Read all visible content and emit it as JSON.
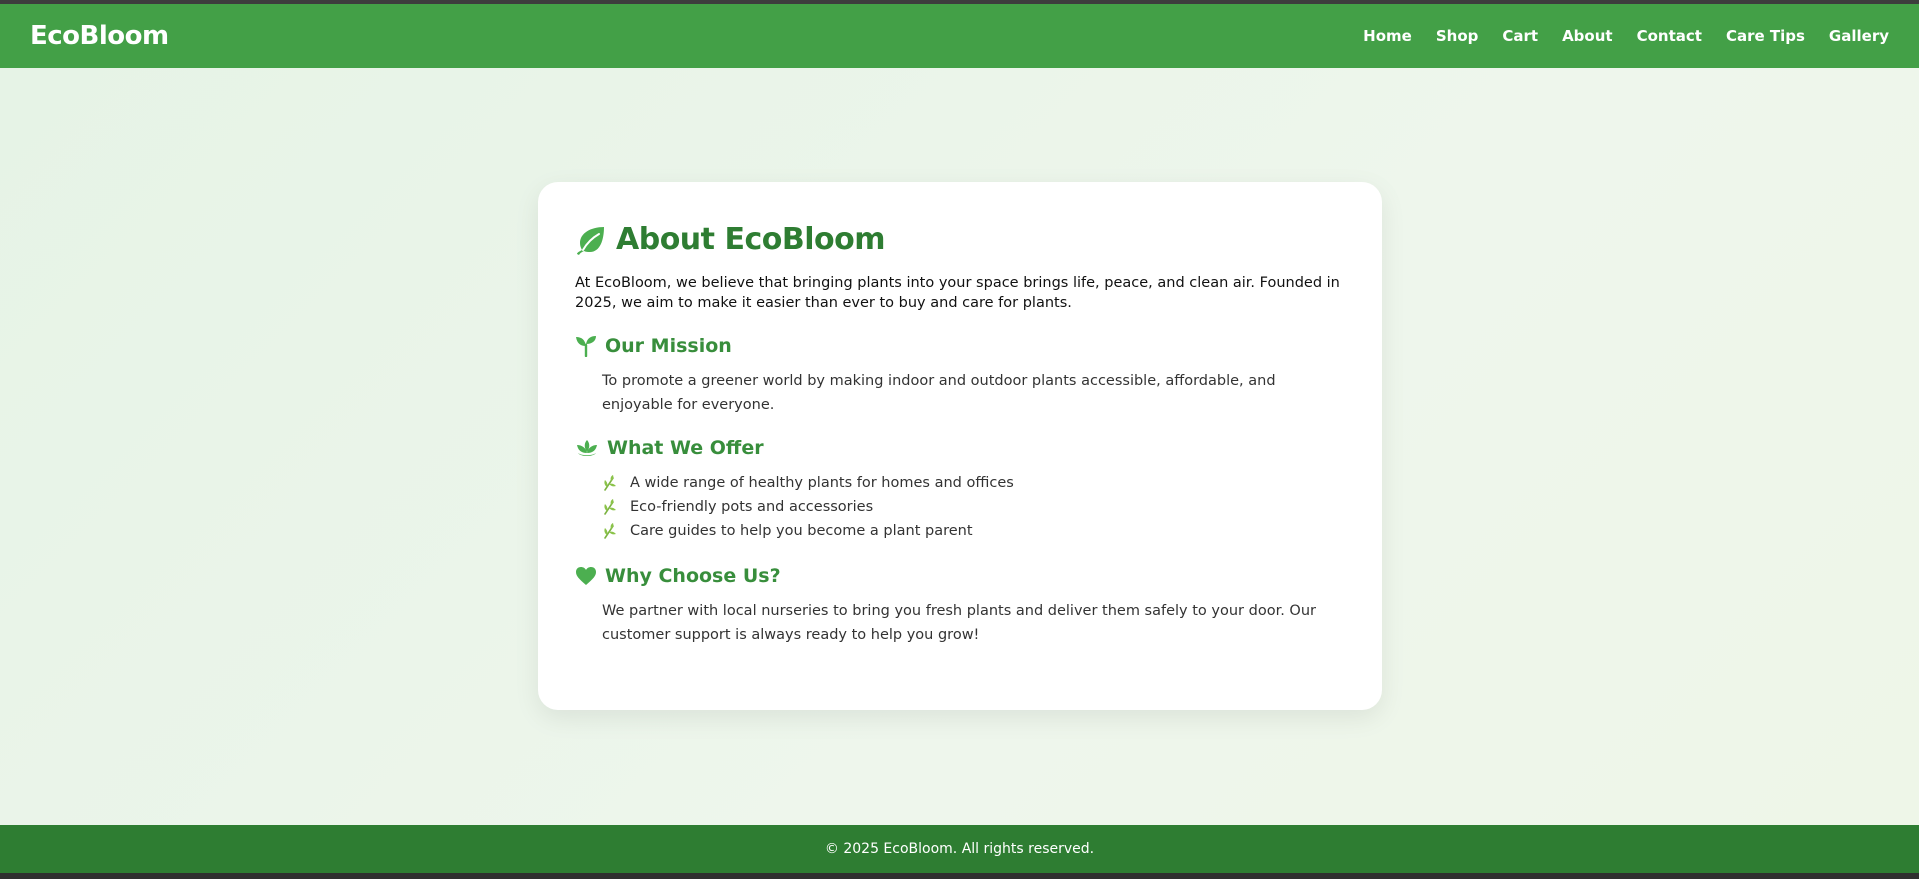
{
  "brand": "EcoBloom",
  "nav": [
    {
      "label": "Home"
    },
    {
      "label": "Shop"
    },
    {
      "label": "Cart"
    },
    {
      "label": "About"
    },
    {
      "label": "Contact"
    },
    {
      "label": "Care Tips"
    },
    {
      "label": "Gallery"
    }
  ],
  "about": {
    "title": "About EcoBloom",
    "title_icon": "leaf-icon",
    "intro": "At EcoBloom, we believe that bringing plants into your space brings life, peace, and clean air. Founded in 2025, we aim to make it easier than ever to buy and care for plants.",
    "mission": {
      "icon": "seedling-icon",
      "title": "Our Mission",
      "text": "To promote a greener world by making indoor and outdoor plants accessible, affordable, and enjoyable for everyone."
    },
    "offer": {
      "icon": "lotus-icon",
      "title": "What We Offer",
      "bullet_icon": "sprig-icon",
      "items": [
        "A wide range of healthy plants for homes and offices",
        "Eco-friendly pots and accessories",
        "Care guides to help you become a plant parent"
      ]
    },
    "why": {
      "icon": "heart-icon",
      "title": "Why Choose Us?",
      "text": "We partner with local nurseries to bring you fresh plants and deliver them safely to your door. Our customer support is always ready to help you grow!"
    }
  },
  "footer": {
    "text": "© 2025 EcoBloom. All rights reserved."
  },
  "colors": {
    "header": "#43a047",
    "footer": "#2e7d32",
    "title": "#2e7d32",
    "section_title": "#388e3c",
    "background": "#e8f5e9",
    "card": "#ffffff"
  }
}
